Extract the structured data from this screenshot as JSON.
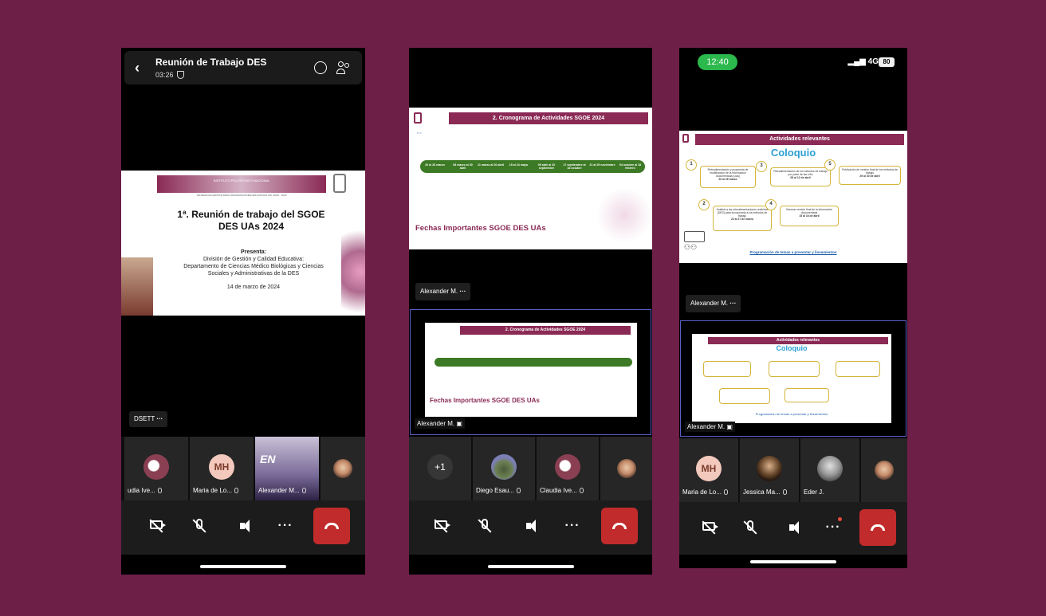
{
  "phone1": {
    "call_title": "Reunión de Trabajo DES",
    "call_time": "03:26",
    "slide": {
      "header_lines": [
        "INSTITUTO POLITÉCNICO NACIONAL",
        "SISTEMA DE GESTIÓN PARA ORGANIZACIONES EDUCATIVAS ISO 21001 : 2018"
      ],
      "title_line1": "1ª. Reunión de trabajo del SGOE",
      "title_line2": "DES UAs 2024",
      "presenta": "Presenta:",
      "line1": "División de Gestión y Calidad Educativa:",
      "line2": "Departamento de Ciencias Médico Biológicas y Ciencias",
      "line3": "Sociales y Administrativas de la DES",
      "date": "14 de marzo de 2024"
    },
    "presenter_chip": "DSETT",
    "participants": [
      {
        "name": "udia Ive...",
        "avatar": "photo",
        "color": "#8b3f52"
      },
      {
        "name": "Maria de Lo...",
        "initials": "MH"
      },
      {
        "name": "Alexander M...",
        "avatar": "video",
        "color": "#b9b2c9"
      },
      {
        "name": "",
        "avatar": "photo",
        "color": "#c58b6a"
      }
    ]
  },
  "phone2": {
    "slide_title": "2. Cronograma de Actividades SGOE 2024",
    "slide_footer": "Fechas Importantes SGOE DES UAs",
    "timeline_dates": [
      "20 al 26 marzo",
      "08 marzo al 30 abril",
      "11 marzo al 20 abril",
      "15 al 24 mayo",
      "09 abril al 20 septiembre",
      "17 septiembre al 18 octubre",
      "21 al 29 noviembre",
      "04 octubre al 18 febrero"
    ],
    "chip": "Alexander M.",
    "thumb_label": "Alexander M.",
    "overflow_count": "+1",
    "participants": [
      {
        "name": "Diego Esau...",
        "avatar": "photo",
        "color": "#5a6b4a"
      },
      {
        "name": "Claudia Ive...",
        "avatar": "photo",
        "color": "#8b3f52"
      },
      {
        "name": "",
        "avatar": "photo",
        "color": "#c58b6a"
      }
    ]
  },
  "phone3": {
    "time": "12:40",
    "network": "4G",
    "battery": "80",
    "slide_header": "Actividades relevantes",
    "slide_subtitle": "Coloquio",
    "boxes": [
      {
        "n": "1",
        "text": "Retroalimentación y propuesta de modificación de la información documentada (UAs)",
        "date": "20 al 26 marzo"
      },
      {
        "n": "3",
        "text": "Retroalimentación de los métodos de trabajo por parte de las UAs",
        "date": "08 al 12 de abril"
      },
      {
        "n": "5",
        "text": "Publicación de versión final de los métodos de trabajo",
        "date": "29 al 30 de abril"
      },
      {
        "n": "2",
        "text": "Análisis a las retroalimentaciones recibidas (DES) para incorporarla a los métodos de trabajo",
        "date": "22 al 27 de marzo"
      },
      {
        "n": "4",
        "text": "Generar versión final de la información documentada",
        "date": "15 al 16 de abril"
      }
    ],
    "slide_link": "Programación de temas a presentar y lineamientos",
    "chip": "Alexander M.",
    "thumb_label": "Alexander M.",
    "participants": [
      {
        "name": "Maria de Lo...",
        "initials": "MH"
      },
      {
        "name": "Jessica Ma...",
        "avatar": "photo",
        "color": "#6b4a2d"
      },
      {
        "name": "Eder J.",
        "avatar": "photo",
        "color": "#9a9a9a"
      },
      {
        "name": "",
        "avatar": "photo",
        "color": "#c58b6a"
      }
    ]
  },
  "colors": {
    "background": "#6e1f48",
    "end_call": "#c22b2b",
    "timeline_green": "#3d7a25",
    "slide_maroon": "#8a2a55",
    "coloquio_blue": "#2b9fd2",
    "box_gold": "#d4b53a",
    "clock_green": "#2bb84c"
  }
}
